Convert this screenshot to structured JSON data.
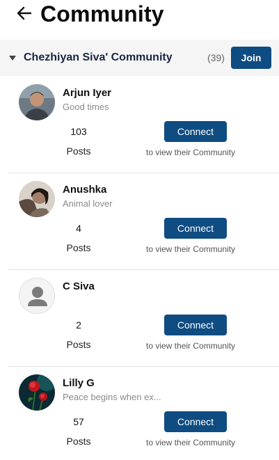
{
  "header": {
    "title": "Community",
    "back_icon": "arrow-left-icon"
  },
  "group": {
    "name": "Chezhiyan Siva' Community",
    "count": "(39)",
    "join_label": "Join",
    "caret_icon": "caret-down-icon"
  },
  "colors": {
    "accent": "#0f4c81",
    "group_bar_bg": "#f5f5f6"
  },
  "members": [
    {
      "name": "Arjun Iyer",
      "bio": "Good times",
      "posts": "103",
      "posts_label": "Posts",
      "connect_label": "Connect",
      "hint": "to view their Community",
      "avatar": "photo-avatar"
    },
    {
      "name": "Anushka",
      "bio": "Animal lover",
      "posts": "4",
      "posts_label": "Posts",
      "connect_label": "Connect",
      "hint": "to view their Community",
      "avatar": "photo-avatar"
    },
    {
      "name": "C Siva",
      "bio": "",
      "posts": "2",
      "posts_label": "Posts",
      "connect_label": "Connect",
      "hint": "to view their Community",
      "avatar": "default-user-icon"
    },
    {
      "name": "Lilly G",
      "bio": "Peace begins when ex...",
      "posts": "57",
      "posts_label": "Posts",
      "connect_label": "Connect",
      "hint": "to view their Community",
      "avatar": "rose-photo-avatar"
    }
  ]
}
